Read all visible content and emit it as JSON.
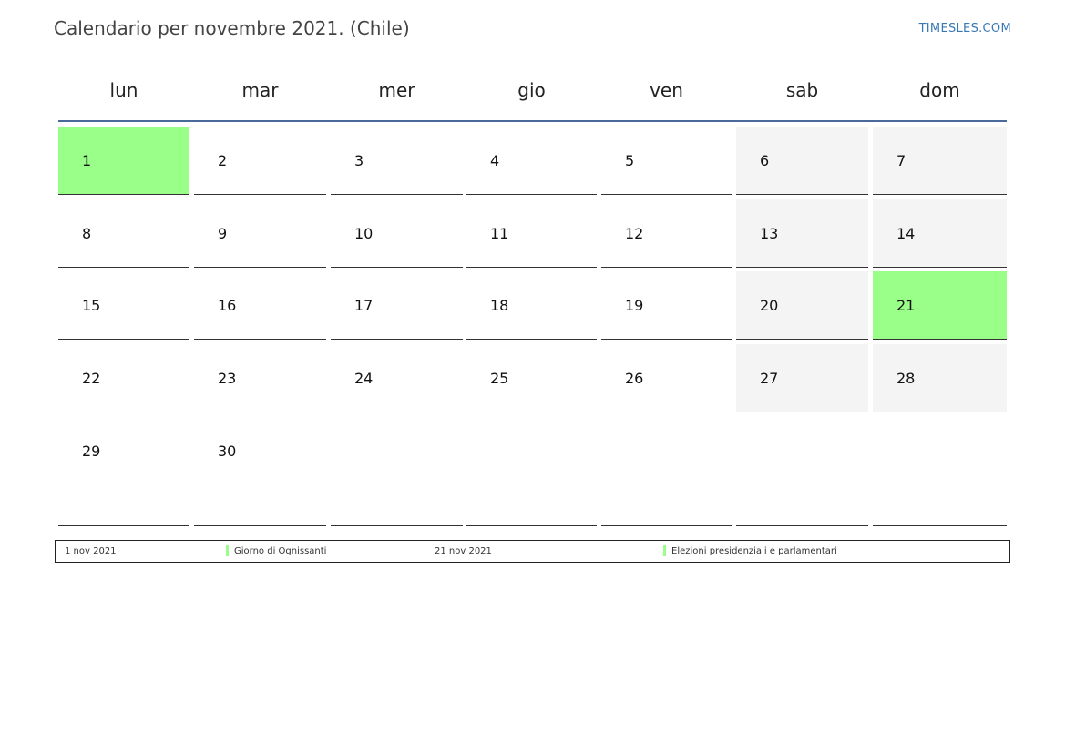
{
  "title": "Calendario per novembre 2021. (Chile)",
  "site": "TIMESLES.COM",
  "colors": {
    "holiday": "#99ff88",
    "weekend": "#f4f4f4",
    "header_rule": "#4a6a9a",
    "site_link": "#3a78b5"
  },
  "weekdays": [
    "lun",
    "mar",
    "mer",
    "gio",
    "ven",
    "sab",
    "dom"
  ],
  "weeks": [
    [
      "1",
      "2",
      "3",
      "4",
      "5",
      "6",
      "7"
    ],
    [
      "8",
      "9",
      "10",
      "11",
      "12",
      "13",
      "14"
    ],
    [
      "15",
      "16",
      "17",
      "18",
      "19",
      "20",
      "21"
    ],
    [
      "22",
      "23",
      "24",
      "25",
      "26",
      "27",
      "28"
    ],
    [
      "29",
      "30",
      "",
      "",
      "",
      "",
      ""
    ]
  ],
  "holiday_days": [
    "1",
    "21"
  ],
  "legend": [
    {
      "date": "1 nov 2021",
      "name": "Giorno di Ognissanti"
    },
    {
      "date": "21 nov 2021",
      "name": "Elezioni presidenziali e parlamentari"
    }
  ]
}
